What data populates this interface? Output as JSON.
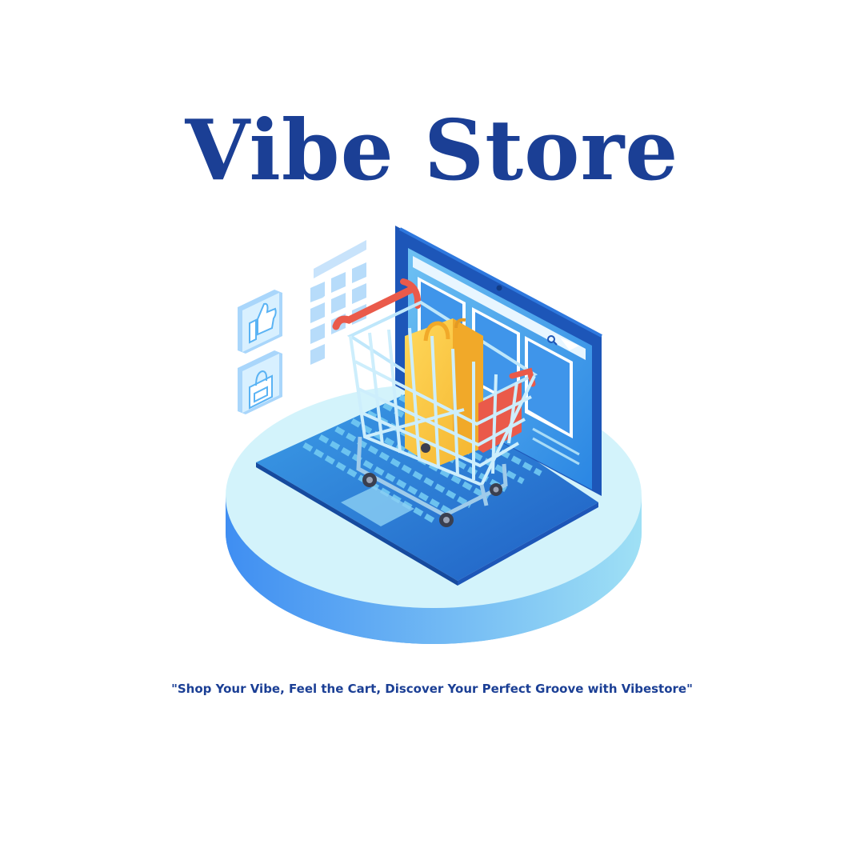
{
  "brand": {
    "title": "Vibe Store",
    "tagline": "\"Shop Your Vibe, Feel the Cart, Discover Your Perfect Groove with Vibestore\""
  },
  "illustration": {
    "icons": [
      "thumbs-up-icon",
      "shopping-bag-icon",
      "app-grid-icon",
      "laptop-icon",
      "shopping-cart-icon",
      "search-icon"
    ]
  },
  "colors": {
    "brand_blue": "#1b3f95",
    "platform_top": "#d3f3fb",
    "platform_side": "#4ea0f5",
    "laptop_blue": "#2b7fe0",
    "laptop_dark": "#1d56b8",
    "cart_red": "#ea5a4a",
    "bag_yellow": "#f9c53d"
  }
}
